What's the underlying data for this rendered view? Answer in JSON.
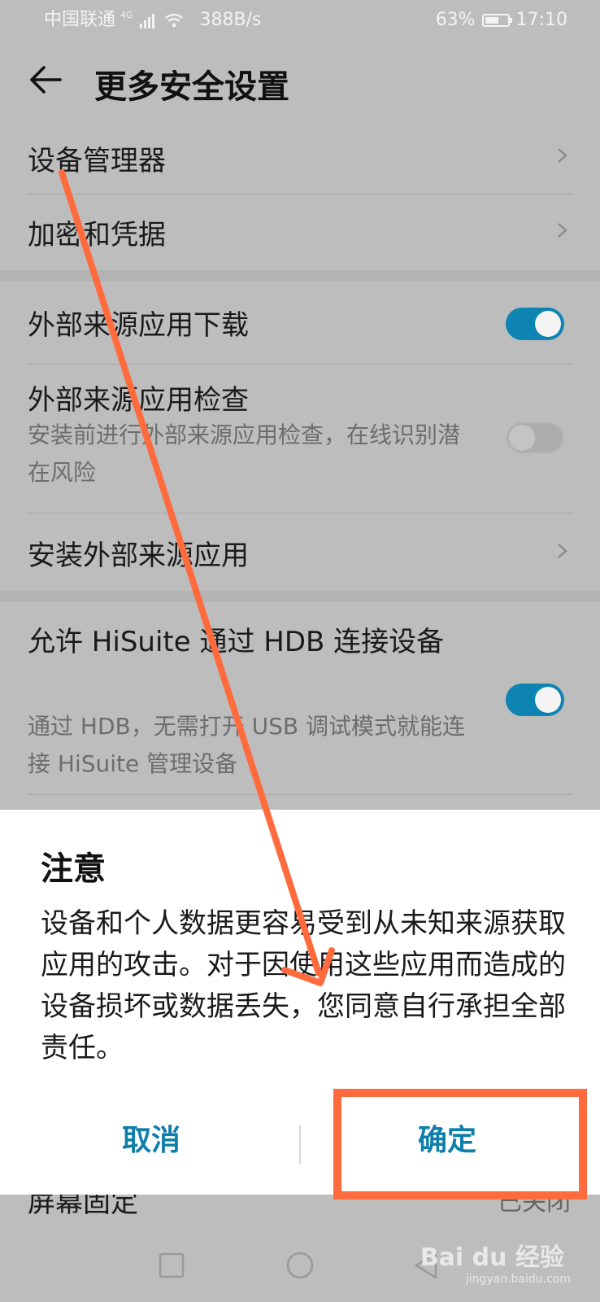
{
  "status_bar": {
    "carrier": "中国联通",
    "network": "4G",
    "speed": "388B/s",
    "battery": "63%",
    "battery_level": 0.63,
    "time": "17:10"
  },
  "app_bar": {
    "title": "更多安全设置",
    "back_icon": "back-arrow-icon"
  },
  "settings": [
    {
      "title": "设备管理器",
      "control": "chevron"
    },
    {
      "title": "加密和凭据",
      "control": "chevron"
    },
    {
      "title": "外部来源应用下载",
      "control": "toggle",
      "on": true
    },
    {
      "title": "外部来源应用检查",
      "subtitle": "安装前进行外部来源应用检查，在线识别潜在风险",
      "control": "toggle",
      "on": false
    },
    {
      "title": "安装外部来源应用",
      "control": "chevron"
    },
    {
      "title": "允许 HiSuite 通过 HDB 连接设备",
      "subtitle": "通过 HDB，无需打开 USB 调试模式就能连接 HiSuite 管理设备",
      "control": "toggle",
      "on": true
    }
  ],
  "below_dialog": {
    "title": "屏幕固定",
    "value": "已关闭"
  },
  "dialog": {
    "title": "注意",
    "message": "设备和个人数据更容易受到从未知来源获取应用的攻击。对于因使用这些应用而造成的设备损坏或数据丢失，您同意自行承担全部责任。",
    "cancel_label": "取消",
    "confirm_label": "确定"
  },
  "watermark": {
    "brand": "Bai du 经验",
    "url": "jingyan.baidu.com"
  },
  "colors": {
    "accent": "#0f7fa9",
    "toggle_on": "#0e84b3",
    "annotation": "#ff6b3d"
  }
}
